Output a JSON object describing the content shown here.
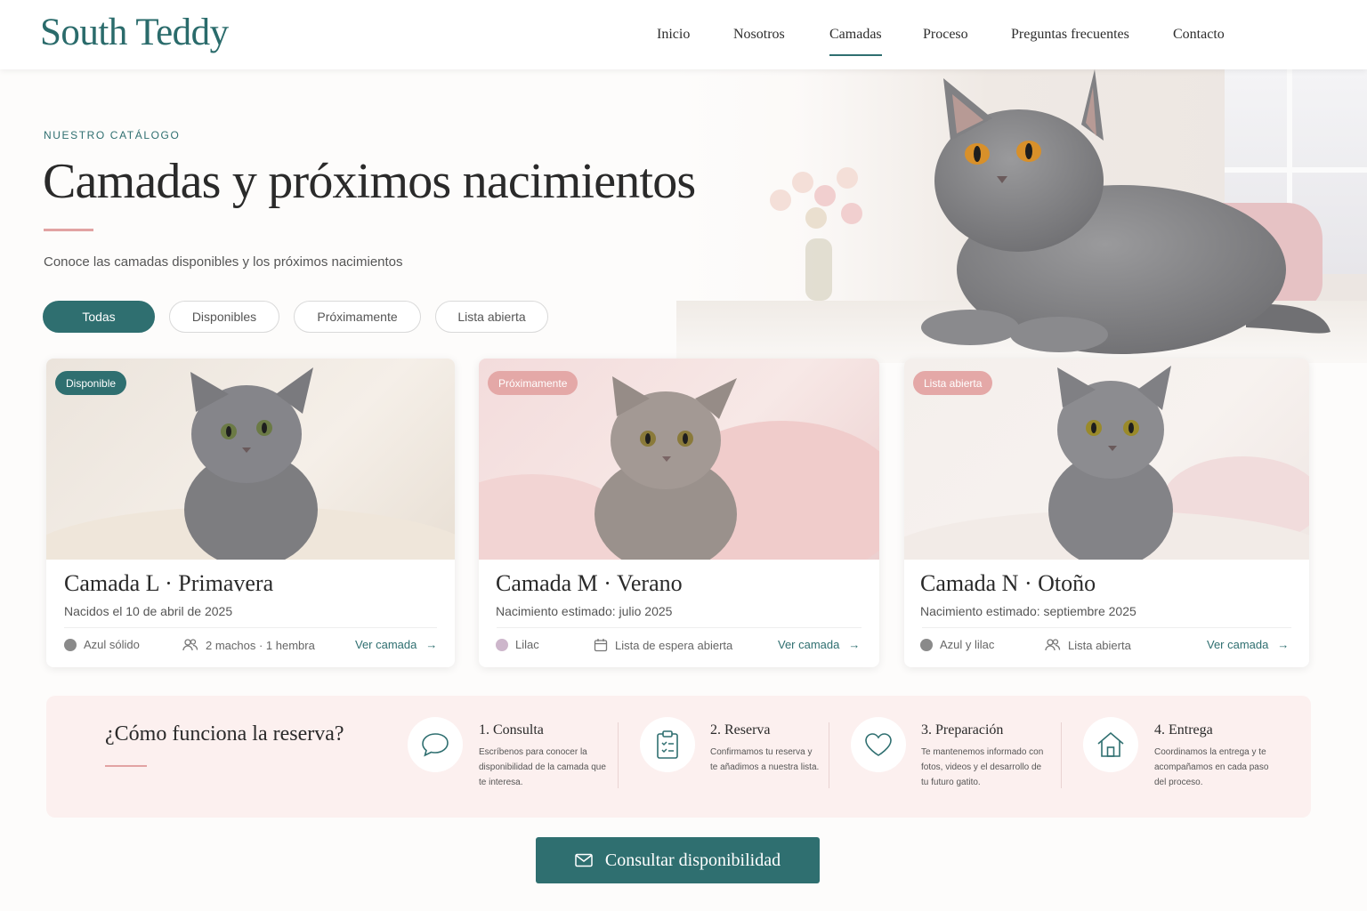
{
  "brand": {
    "name": "South Teddy"
  },
  "nav": {
    "items": [
      {
        "label": "Inicio"
      },
      {
        "label": "Nosotros"
      },
      {
        "label": "Camadas",
        "active": true
      },
      {
        "label": "Proceso"
      },
      {
        "label": "Preguntas frecuentes"
      },
      {
        "label": "Contacto"
      }
    ]
  },
  "hero": {
    "eyebrow": "NUESTRO CATÁLOGO",
    "title": "Camadas y próximos nacimientos",
    "subtitle": "Conoce las camadas disponibles y los próximos nacimientos"
  },
  "filters": [
    {
      "label": "Todas",
      "active": true
    },
    {
      "label": "Disponibles"
    },
    {
      "label": "Próximamente"
    },
    {
      "label": "Lista abierta"
    }
  ],
  "cards": [
    {
      "badge": "Disponible",
      "badge_color": "#2f6f70",
      "title": "Camada L · Primavera",
      "subtitle": "Nacidos el 10 de abril de 2025",
      "color_label": "Azul sólido",
      "color_dot": "#8a8a8a",
      "info_icon": "users-icon",
      "info": "2 machos · 1 hembra",
      "link": "Ver camada"
    },
    {
      "badge": "Próximamente",
      "badge_color": "#e4a8a7",
      "title": "Camada M · Verano",
      "subtitle": "Nacimiento estimado: julio 2025",
      "color_label": "Lilac",
      "color_dot": "#cdb6cb",
      "info_icon": "calendar-icon",
      "info": "Lista de espera abierta",
      "link": "Ver camada"
    },
    {
      "badge": "Lista abierta",
      "badge_color": "#e4a8a7",
      "title": "Camada N · Otoño",
      "subtitle": "Nacimiento estimado: septiembre 2025",
      "color_label": "Azul y lilac",
      "color_dot": "#8a8a8a",
      "info_icon": "users-icon",
      "info": "Lista abierta",
      "link": "Ver camada"
    }
  ],
  "process": {
    "title": "¿Cómo funciona la reserva?",
    "steps": [
      {
        "icon": "chat-bubble-icon",
        "title": "1. Consulta",
        "text": "Escríbenos para conocer la disponibilidad de la camada que te interesa."
      },
      {
        "icon": "clipboard-icon",
        "title": "2. Reserva",
        "text": "Confirmamos tu reserva y te añadimos a nuestra lista."
      },
      {
        "icon": "heart-icon",
        "title": "3. Preparación",
        "text": "Te mantenemos informado con fotos, videos y el desarrollo de tu futuro gatito."
      },
      {
        "icon": "house-icon",
        "title": "4. Entrega",
        "text": "Coordinamos la entrega y te acompañamos en cada paso del proceso."
      }
    ]
  },
  "cta": {
    "label": "Consultar disponibilidad",
    "icon": "mail-icon"
  },
  "colors": {
    "accent": "#2f6f70",
    "rose": "#e2a3a3",
    "panel": "#fcf0ef"
  }
}
